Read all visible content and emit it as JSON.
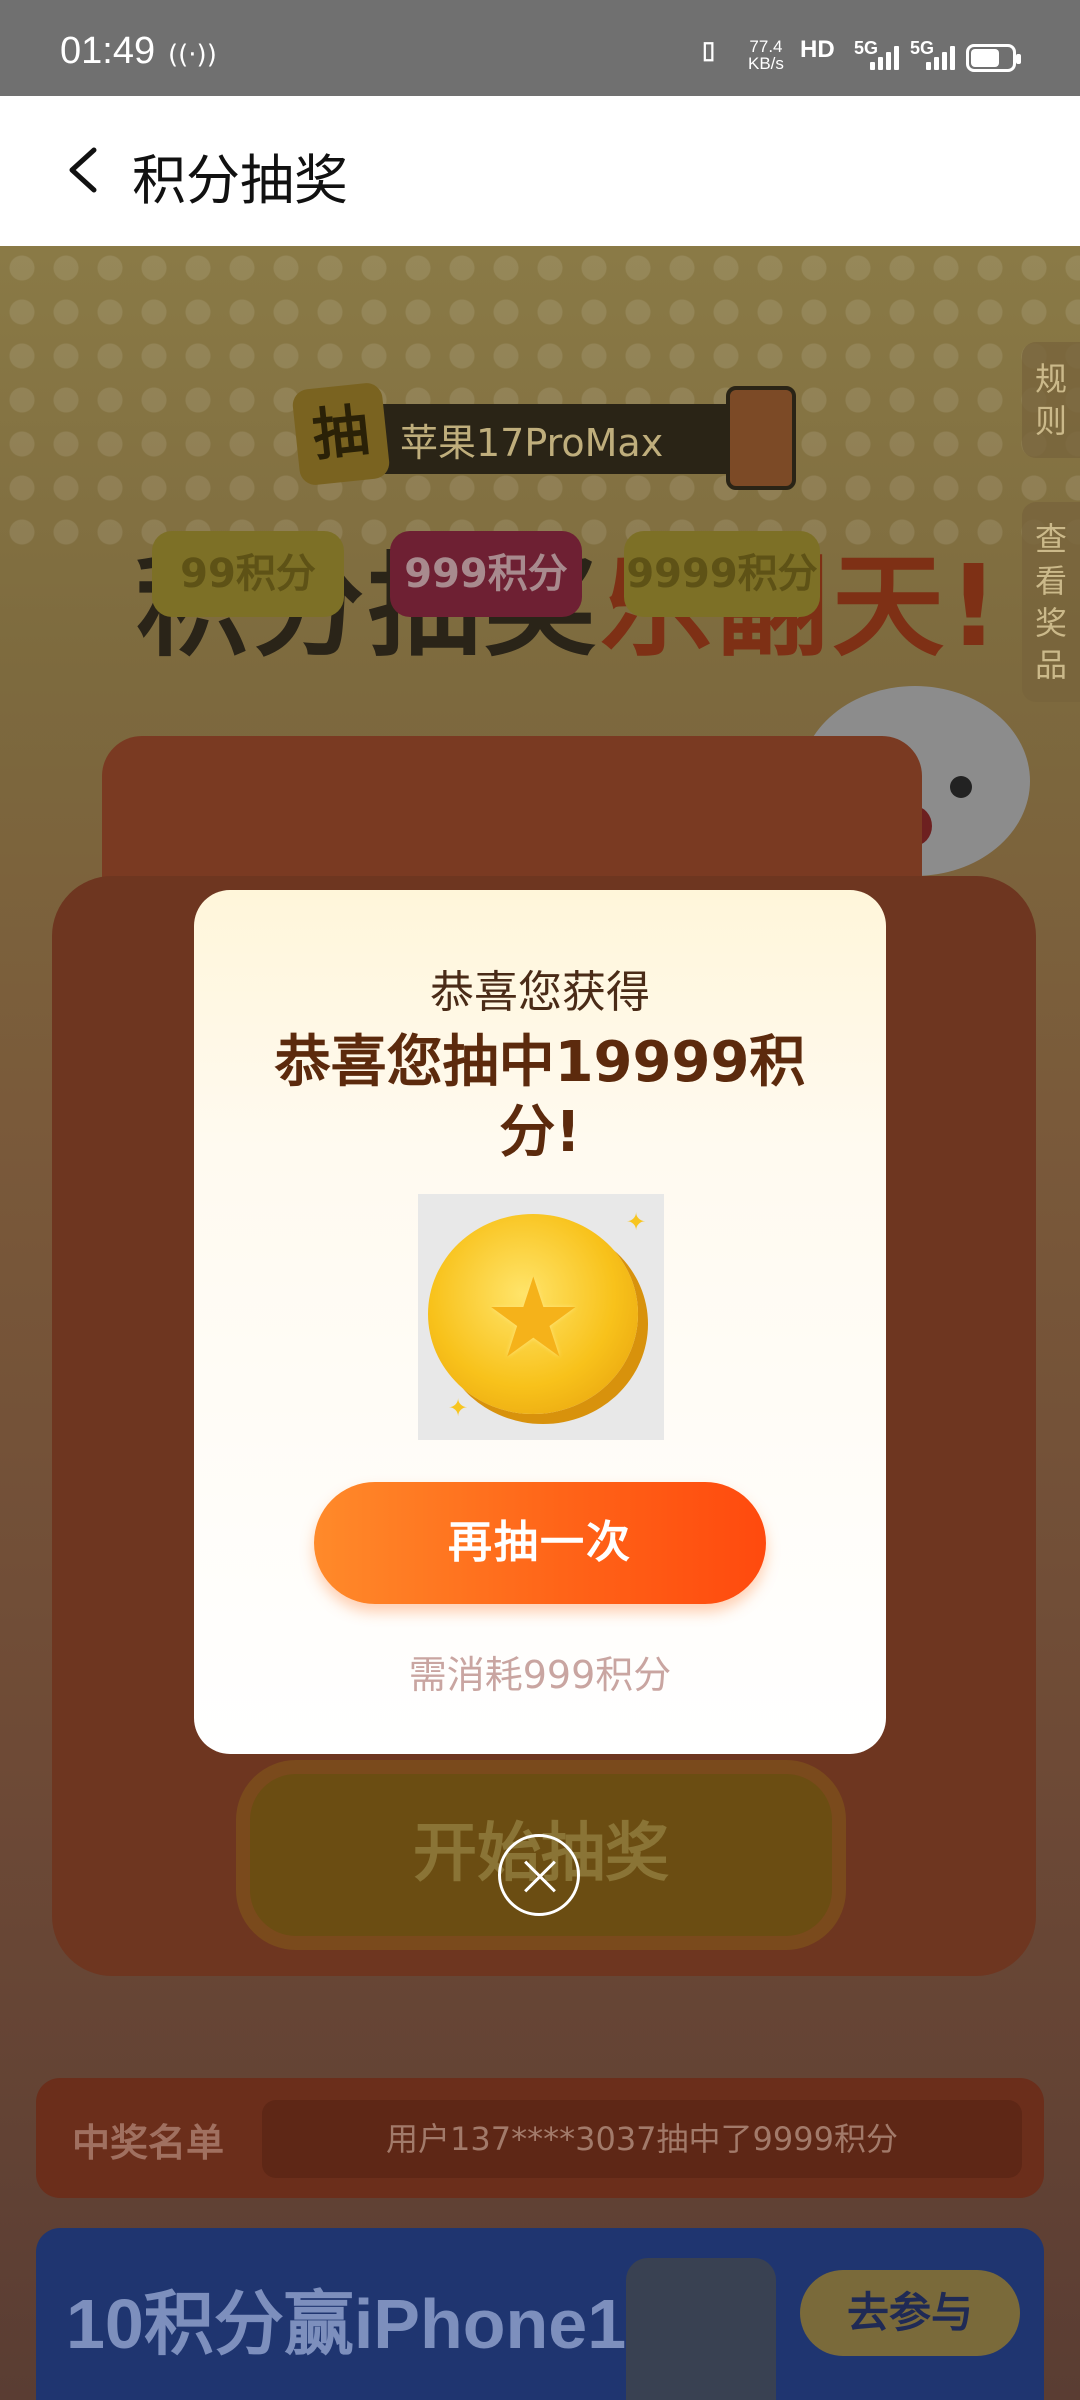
{
  "status_bar": {
    "time": "01:49",
    "net_speed_value": "77.4",
    "net_speed_unit": "KB/s",
    "hd_label": "HD",
    "sim1_label": "5G",
    "sim2_label": "5G"
  },
  "nav": {
    "title": "积分抽奖"
  },
  "side_tabs": {
    "rules": "规则",
    "view_prizes": "查看奖品"
  },
  "promo": {
    "tag_char": "抽",
    "tag_text": "苹果17ProMax",
    "title_part1": "积分抽奖",
    "title_part2": "乐翻天!"
  },
  "tiers": [
    "99积分",
    "999积分",
    "9999积分"
  ],
  "start_button": "开始抽奖",
  "winners": {
    "label": "中奖名单",
    "ticker": "用户137****3037抽中了9999积分"
  },
  "banner": {
    "text": "10积分赢iPhone17",
    "cta": "去参与"
  },
  "modal": {
    "subtitle": "恭喜您获得",
    "title": "恭喜您抽中19999积分!",
    "again_button": "再抽一次",
    "cost_note": "需消耗999积分",
    "prize_icon": "gold-coin-icon"
  },
  "colors": {
    "accent": "#ff6418",
    "modal_title": "#5c2a0d"
  }
}
